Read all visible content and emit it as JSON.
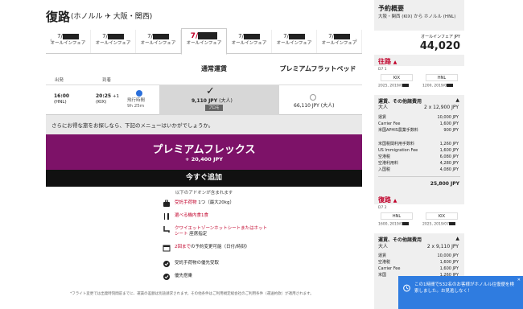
{
  "header": {
    "title": "復路",
    "route": "(ホノルル ✈ 大阪・関西)"
  },
  "date_tabs": [
    {
      "date": "7/",
      "fare": "オールインフェア"
    },
    {
      "date": "7/",
      "fare": "オールインフェア"
    },
    {
      "date": "7/",
      "fare": "オールインフェア"
    },
    {
      "date": "7/",
      "fare": "オールインフェア"
    },
    {
      "date": "7/",
      "fare": "オールインフェア"
    },
    {
      "date": "7/",
      "fare": "オールインフェア"
    },
    {
      "date": "7/",
      "fare": "オールインフェア"
    }
  ],
  "fare_columns": {
    "standard": "通常運賃",
    "premium": "プレミアムフラットベッド",
    "depart": "出発",
    "arrive": "到着"
  },
  "flight": {
    "dep_time": "16:00",
    "dep_code": "(HNL)",
    "arr_time": "20:25",
    "arr_plus": "+1",
    "arr_code": "(KIX)",
    "duration_label": "飛行時間",
    "duration": "9h 25m",
    "standard_price": "9,110 JPY",
    "standard_unit": "(大人)",
    "badge": "プロモ",
    "premium_price": "66,110 JPY (大人)"
  },
  "upsell": {
    "intro": "さらにお得な旅をお探しなら、下記のメニューはいかがでしょうか。",
    "name": "プレミアムフレックス",
    "add_price": "+ 20,400 JPY",
    "add_now": "今すぐ追加",
    "included": "以下のアドオンが含まれます",
    "items": [
      {
        "icon": "luggage-icon",
        "red": "受託手荷物",
        "rest": " 1つ（最大20kg）"
      },
      {
        "icon": "meal-icon",
        "red": "選べる機内食1食",
        "rest": ""
      },
      {
        "icon": "seat-icon",
        "red": "クワイエットゾーンホットシートまたはホットシート",
        "rest": " 座席指定"
      },
      {
        "icon": "calendar-icon",
        "red": "2回まで",
        "rest": "の予約変更可能（日付/時刻）"
      },
      {
        "icon": "check-icon",
        "red": "",
        "rest": "受託手荷物の優先受取"
      },
      {
        "icon": "check-icon",
        "red": "",
        "rest": "優先搭乗"
      }
    ],
    "footnote": "*フライト変更では出発時刻間前までに、運賃の差額は別途請求されます。その他条件はご利用規定総会社のご利用条件（運送約款）が適用されます。"
  },
  "sidebar": {
    "title": "予約概要",
    "route": "大阪・関西 (KIX) から ホノルル (HNL)",
    "total_label": "オールインフェア JPY",
    "total": "44,020",
    "outbound": {
      "label": "往路",
      "flight": "D7 1",
      "from": "KIX",
      "to": "HNL",
      "from_date": "2025, 2019/0",
      "to_date": "1200, 2019/0",
      "section": "運賃、その他諸費用",
      "adult": "大人",
      "adult_price": "2 x 12,900 JPY",
      "lines": [
        {
          "name": "運賃",
          "amount": "10,000 JPY"
        },
        {
          "name": "Carrier Fee",
          "amount": "1,600 JPY"
        },
        {
          "name": "米国APHIS農業手数料",
          "amount": "900 JPY"
        },
        {
          "name": "米国税関利用手数料",
          "amount": "1,260 JPY"
        },
        {
          "name": "US Immigration Fee",
          "amount": "1,600 JPY"
        },
        {
          "name": "空港税",
          "amount": "6,080 JPY"
        },
        {
          "name": "空港利用料",
          "amount": "4,280 JPY"
        },
        {
          "name": "入国税",
          "amount": "4,080 JPY"
        }
      ],
      "sum": "25,800 JPY"
    },
    "return": {
      "label": "復路",
      "flight": "D7 2",
      "from": "HNL",
      "to": "KIX",
      "from_date": "1600, 2019/0",
      "to_date": "2025, 2019/07",
      "section": "運賃、その他諸費用",
      "adult": "大人",
      "adult_price": "2 x 9,110 JPY",
      "lines": [
        {
          "name": "運賃",
          "amount": "10,000 JPY"
        },
        {
          "name": "空港税",
          "amount": "1,600 JPY"
        },
        {
          "name": "Carrier Fee",
          "amount": "1,600 JPY"
        },
        {
          "name": "米国",
          "amount": "1,260 JPY"
        }
      ]
    }
  },
  "toast": {
    "message": "この1時間で532名のお客様がホノルル往復便を検索しました。お見逃しなく！",
    "close": "✕"
  }
}
